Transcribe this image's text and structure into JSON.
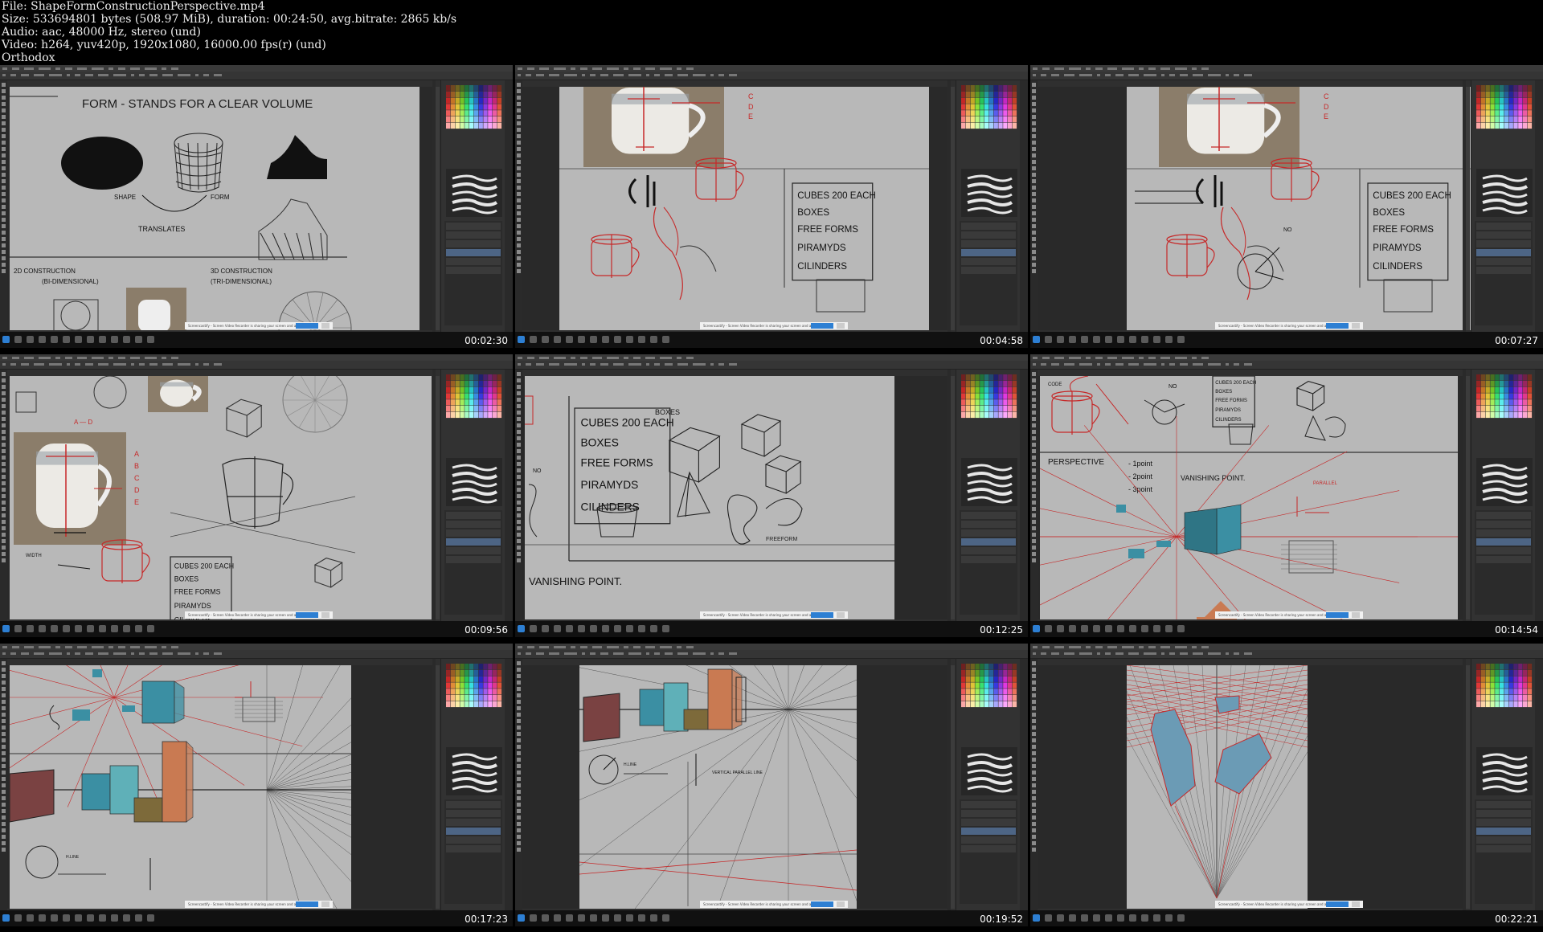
{
  "header": {
    "file": "File: ShapeFormConstructionPerspective.mp4",
    "size": "Size: 533694801 bytes (508.97 MiB), duration: 00:24:50, avg.bitrate: 2865 kb/s",
    "audio": "Audio: aac, 48000 Hz, stereo (und)",
    "video": "Video: h264, yuv420p, 1920x1080, 16000.00 fps(r) (und)",
    "tag": "Orthodox"
  },
  "thumbnails": [
    {
      "timestamp": "00:02:30",
      "scene": "shape-form"
    },
    {
      "timestamp": "00:04:58",
      "scene": "cup-cubes"
    },
    {
      "timestamp": "00:07:27",
      "scene": "cup-cubes-2"
    },
    {
      "timestamp": "00:09:56",
      "scene": "cup-construction"
    },
    {
      "timestamp": "00:12:25",
      "scene": "cubes-list"
    },
    {
      "timestamp": "00:14:54",
      "scene": "perspective"
    },
    {
      "timestamp": "00:17:23",
      "scene": "buildings"
    },
    {
      "timestamp": "00:19:52",
      "scene": "buildings-2"
    },
    {
      "timestamp": "00:22:21",
      "scene": "three-point"
    }
  ],
  "canvas_text": {
    "form_line": "FORM - STANDS FOR A CLEAR VOLUME",
    "shape": "SHAPE",
    "form": "FORM",
    "translates": "TRANSLATES",
    "d2": "2D CONSTRUCTION",
    "d2b": "(BI-DIMENSIONAL)",
    "d3": "3D CONSTRUCTION",
    "d3b": "(TRI-DIMENSIONAL)",
    "cubes": "CUBES 200 EACH",
    "boxes": "BOXES",
    "free": "FREE FORMS",
    "piramyds": "PIRAMYDS",
    "cilinders": "CILINDERS",
    "perspective": "PERSPECTIVE",
    "p1": "- 1point",
    "p2": "- 2point",
    "p3": "- 3point",
    "vp": "VANISHING POINT.",
    "abcde": "A B C D E",
    "freeform": "FREEFORM"
  },
  "notice": {
    "text": "Screencastify - Screen Video Recorder is sharing your screen and audio.",
    "stop": "Stop sharing",
    "hide": "Hide"
  },
  "colors": {
    "canvas": "#b8b8b8",
    "red_line": "#c62828",
    "teal": "#3b8fa3",
    "orange": "#c97a52",
    "maroon": "#7a4242",
    "olive": "#7d6a3a"
  }
}
